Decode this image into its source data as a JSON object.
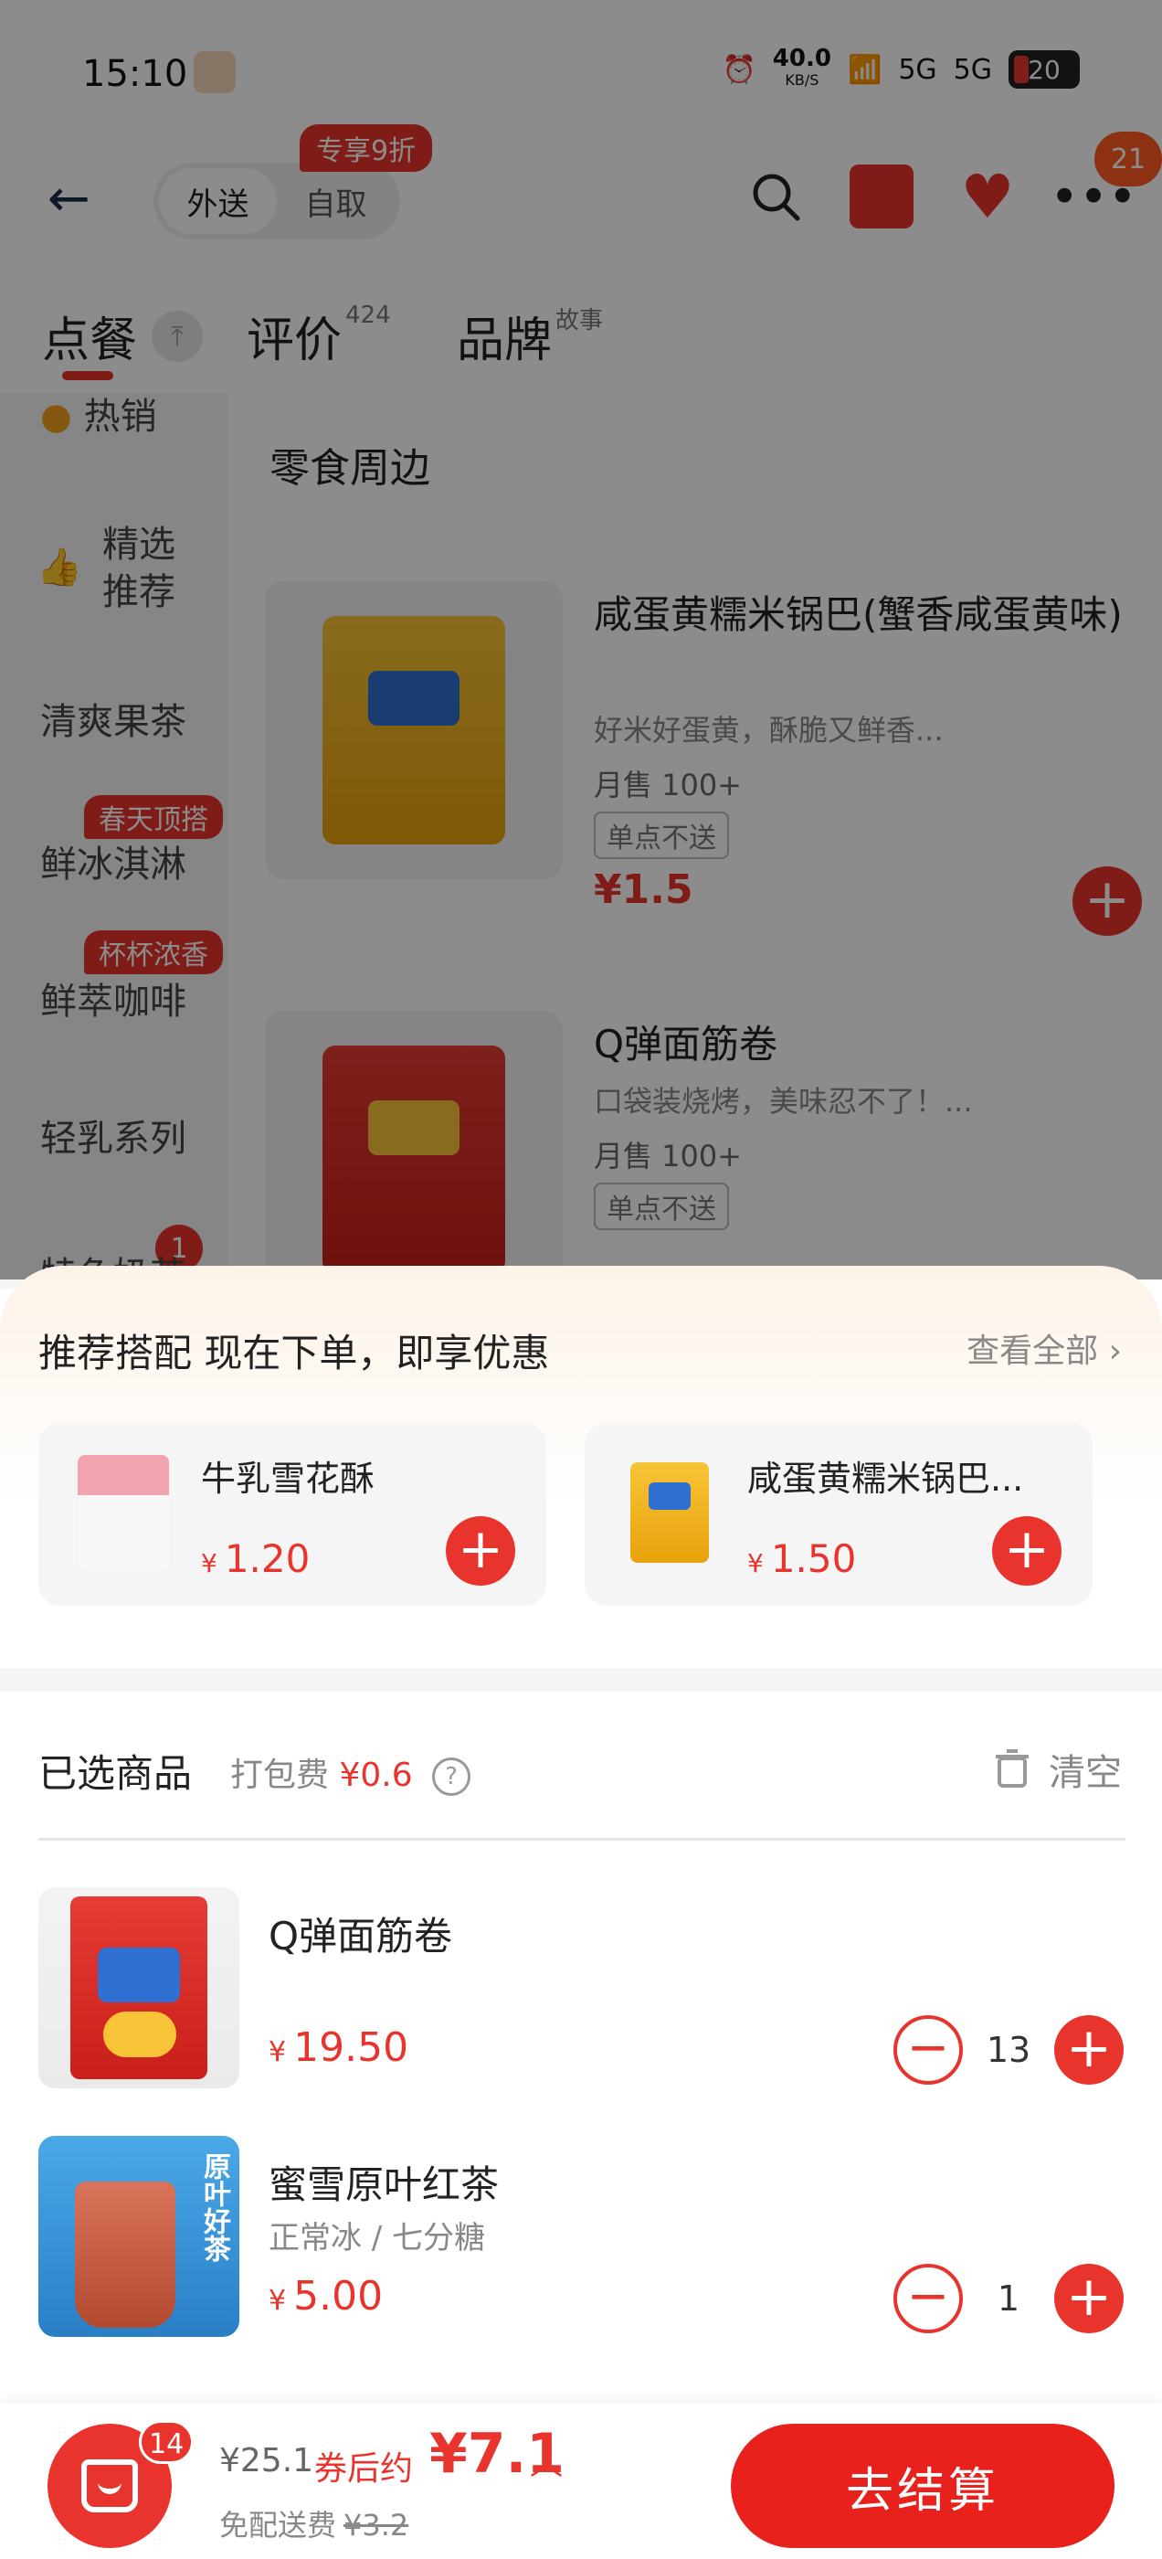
{
  "status_bar": {
    "time": "15:10",
    "net_speed": "40.0",
    "net_unit": "KB/S",
    "sim1": "5G",
    "sim2": "5G",
    "battery": "20"
  },
  "header": {
    "mode_delivery": "外送",
    "mode_pickup": "自取",
    "pickup_badge": "专享9折",
    "message_count": "21"
  },
  "tabs": [
    {
      "label": "点餐",
      "sup": ""
    },
    {
      "label": "评价",
      "sup": "424"
    },
    {
      "label": "品牌",
      "sup": "故事"
    }
  ],
  "sidebar": {
    "items": [
      {
        "label": "热销"
      },
      {
        "label": "精选\n推荐"
      },
      {
        "label": "清爽果茶"
      },
      {
        "label": "鲜冰淇淋",
        "tag": "春天顶搭"
      },
      {
        "label": "鲜萃咖啡",
        "tag": "杯杯浓香"
      },
      {
        "label": "轻乳系列"
      },
      {
        "label": "特色奶茶",
        "count": "1"
      }
    ]
  },
  "menu": {
    "section_title": "零食周边",
    "products": [
      {
        "name": "咸蛋黄糯米锅巴(蟹香咸蛋黄味)",
        "desc": "好米好蛋黄，酥脆又鲜香...",
        "sales": "月售 100+",
        "tag": "单点不送",
        "price": "¥1.5"
      },
      {
        "name": "Q弹面筋卷",
        "desc": "口袋装烧烤，美味忍不了！...",
        "sales": "月售 100+",
        "tag": "单点不送",
        "price": ""
      }
    ]
  },
  "recommend": {
    "title": "推荐搭配  现在下单，即享优惠",
    "more": "查看全部",
    "items": [
      {
        "name": "牛乳雪花酥",
        "currency": "¥",
        "price": "1.20"
      },
      {
        "name": "咸蛋黄糯米锅巴...",
        "currency": "¥",
        "price": "1.50"
      }
    ]
  },
  "selected": {
    "title": "已选商品",
    "packing_label": "打包费",
    "packing_fee": "¥0.6",
    "clear": "清空",
    "items": [
      {
        "name": "Q弹面筋卷",
        "spec": "",
        "currency": "¥",
        "price": "19.50",
        "qty": "13"
      },
      {
        "name": "蜜雪原叶红茶",
        "spec": "正常冰 / 七分糖",
        "currency": "¥",
        "price": "5.00",
        "qty": "1"
      }
    ]
  },
  "checkout": {
    "cart_count": "14",
    "original_total": "¥25.1",
    "coupon_label": "券后约",
    "after_price": "¥7.1",
    "delivery_label": "免配送费",
    "delivery_original": "¥3.2",
    "button": "去结算"
  },
  "colors": {
    "accent": "#e8342d",
    "overlay": "rgba(0,0,0,0.45)"
  }
}
